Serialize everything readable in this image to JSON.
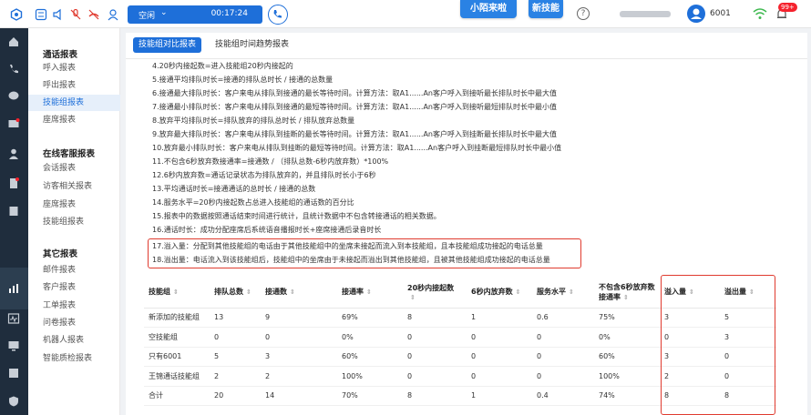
{
  "topbar": {
    "status": "空闲",
    "timer": "00:17:24",
    "banner_left": "小陌来啦",
    "banner_right": "新技能",
    "help": "?",
    "extension": "6001",
    "badge": "99+"
  },
  "rail_icons": [
    "home-icon",
    "phone-icon",
    "chat-icon",
    "mail-icon",
    "user-icon",
    "clipboard-icon",
    "book-icon",
    "chart-icon",
    "pulse-icon",
    "monitor-icon",
    "list-icon",
    "shield-icon",
    "settings-icon"
  ],
  "nav": {
    "groups": [
      {
        "title": "通话报表",
        "items": [
          "呼入报表",
          "呼出报表",
          "技能组报表",
          "座席报表"
        ]
      },
      {
        "title": "在线客服报表",
        "items": [
          "会话报表",
          "访客相关报表",
          "座席报表",
          "技能组报表"
        ]
      },
      {
        "title": "其它报表",
        "items": [
          "邮件报表",
          "客户报表",
          "工单报表",
          "问卷报表",
          "机器人报表",
          "智能质检报表"
        ]
      }
    ],
    "active": "技能组报表"
  },
  "tabs": {
    "active": "技能组对比报表",
    "other": "技能组时间趋势报表"
  },
  "notes": [
    "4.20秒内接起数=进入技能组20秒内接起的",
    "5.接通平均排队时长=接通的排队总时长 / 接通的总数量",
    "6.接通最大排队时长：客户来电从排队到接通的最长等待时间。计算方法：取A1......An客户呼入到接听最长排队时长中最大值",
    "7.接通最小排队时长：客户来电从排队到接通的最短等待时间。计算方法：取A1......An客户呼入到接听最短排队时长中最小值",
    "8.放弃平均排队时长=排队放弃的排队总时长 / 排队放弃总数量",
    "9.放弃最大排队时长：客户来电从排队到挂断的最长等待时间。计算方法：取A1......An客户呼入到挂断最长排队时长中最大值",
    "10.放弃最小排队时长：客户来电从排队到挂断的最短等待时间。计算方法：取A1......An客户呼入到挂断最短排队时长中最小值",
    "11.不包含6秒放弃数接通率=接通数 / （排队总数-6秒内放弃数）*100%",
    "12.6秒内放弃数=通话记录状态为排队放弃的，并且排队时长小于6秒",
    "13.平均通话时长=接通通话的总时长 / 接通的总数",
    "14.服务水平=20秒内接起数占总进入技能组的通话数的百分比",
    "15.报表中的数据按照通话结束时间进行统计，且统计数据中不包含转接通话的相关数据。",
    "16.通话时长：成功分配座席后系统语音播报时长+座席接通后录音时长",
    "17.溢入量：分配到其他技能组的电话由于其他技能组中的坐席未接起而流入到本技能组，且本技能组成功接起的电话总量",
    "18.溢出量：电话流入到该技能组后，技能组中的坐席由于未接起而溢出到其他技能组，且被其他技能组成功接起的电话总量"
  ],
  "table": {
    "columns": [
      {
        "line1": "技能组",
        "line2": ""
      },
      {
        "line1": "排队总数",
        "line2": ""
      },
      {
        "line1": "接通数",
        "line2": ""
      },
      {
        "line1": "接通率",
        "line2": ""
      },
      {
        "line1": "20秒内接起数",
        "line2": ""
      },
      {
        "line1": "6秒内放弃数",
        "line2": ""
      },
      {
        "line1": "服务水平",
        "line2": ""
      },
      {
        "line1": "不包含6秒放弃数",
        "line2": "接通率"
      },
      {
        "line1": "溢入量",
        "line2": ""
      },
      {
        "line1": "溢出量",
        "line2": ""
      }
    ],
    "rows": [
      [
        "新添加的技能组",
        "13",
        "9",
        "69%",
        "8",
        "1",
        "0.6",
        "75%",
        "3",
        "5"
      ],
      [
        "空技能组",
        "0",
        "0",
        "0%",
        "0",
        "0",
        "0",
        "0%",
        "0",
        "3"
      ],
      [
        "只有6001",
        "5",
        "3",
        "60%",
        "0",
        "0",
        "0",
        "60%",
        "3",
        "0"
      ],
      [
        "王锦通话技能组",
        "2",
        "2",
        "100%",
        "0",
        "0",
        "0",
        "100%",
        "2",
        "0"
      ],
      [
        "合计",
        "20",
        "14",
        "70%",
        "8",
        "1",
        "0.4",
        "74%",
        "8",
        "8"
      ]
    ]
  },
  "colors": {
    "primary": "#1e6fd9",
    "highlight": "#e03b2f",
    "rail": "#1f2d3d"
  }
}
